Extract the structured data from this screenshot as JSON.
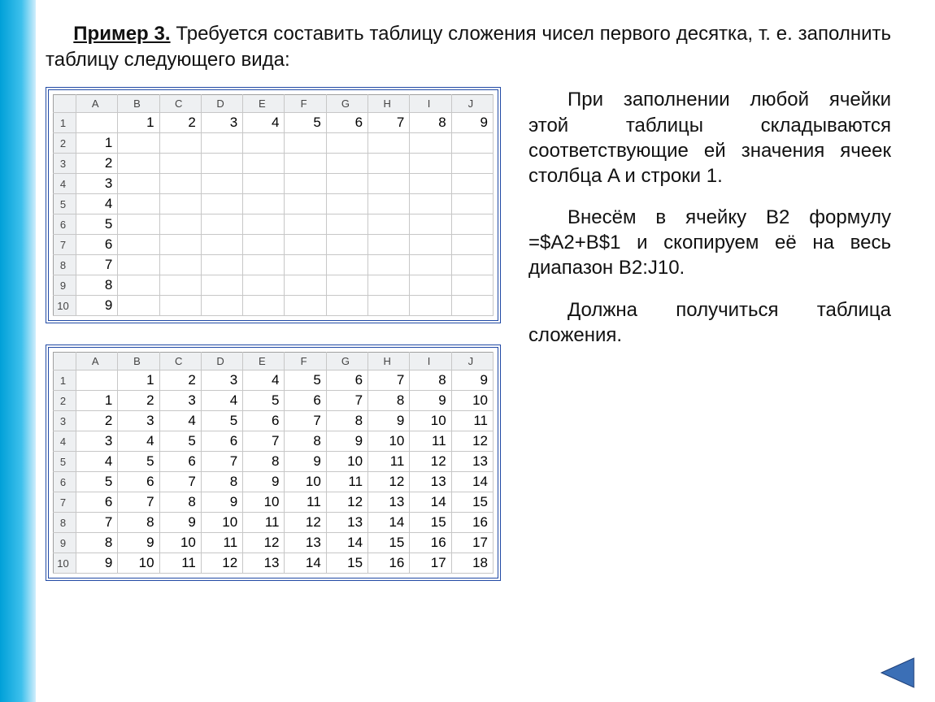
{
  "intro": {
    "example_label": "Пример 3.",
    "text_after": " Требуется составить таблицу сложения чисел первого десятка, т. е. заполнить таблицу следующего вида:"
  },
  "right_text": {
    "p1": "При заполнении любой ячейки этой таблицы складываются соответствующие ей значения ячеек столбца A и строки 1.",
    "p2": "Внесём в ячейку B2 формулу =$A2+B$1 и скопируем её на весь диапазон B2:J10.",
    "p3": "Должна получиться таблица сложения."
  },
  "spreadsheet": {
    "col_labels": [
      "A",
      "B",
      "C",
      "D",
      "E",
      "F",
      "G",
      "H",
      "I",
      "J"
    ],
    "row_labels": [
      "1",
      "2",
      "3",
      "4",
      "5",
      "6",
      "7",
      "8",
      "9",
      "10"
    ]
  },
  "sheet1_data": [
    [
      "",
      "1",
      "2",
      "3",
      "4",
      "5",
      "6",
      "7",
      "8",
      "9"
    ],
    [
      "1",
      "",
      "",
      "",
      "",
      "",
      "",
      "",
      "",
      ""
    ],
    [
      "2",
      "",
      "",
      "",
      "",
      "",
      "",
      "",
      "",
      ""
    ],
    [
      "3",
      "",
      "",
      "",
      "",
      "",
      "",
      "",
      "",
      ""
    ],
    [
      "4",
      "",
      "",
      "",
      "",
      "",
      "",
      "",
      "",
      ""
    ],
    [
      "5",
      "",
      "",
      "",
      "",
      "",
      "",
      "",
      "",
      ""
    ],
    [
      "6",
      "",
      "",
      "",
      "",
      "",
      "",
      "",
      "",
      ""
    ],
    [
      "7",
      "",
      "",
      "",
      "",
      "",
      "",
      "",
      "",
      ""
    ],
    [
      "8",
      "",
      "",
      "",
      "",
      "",
      "",
      "",
      "",
      ""
    ],
    [
      "9",
      "",
      "",
      "",
      "",
      "",
      "",
      "",
      "",
      ""
    ]
  ],
  "sheet2_data": [
    [
      "",
      "1",
      "2",
      "3",
      "4",
      "5",
      "6",
      "7",
      "8",
      "9"
    ],
    [
      "1",
      "2",
      "3",
      "4",
      "5",
      "6",
      "7",
      "8",
      "9",
      "10"
    ],
    [
      "2",
      "3",
      "4",
      "5",
      "6",
      "7",
      "8",
      "9",
      "10",
      "11"
    ],
    [
      "3",
      "4",
      "5",
      "6",
      "7",
      "8",
      "9",
      "10",
      "11",
      "12"
    ],
    [
      "4",
      "5",
      "6",
      "7",
      "8",
      "9",
      "10",
      "11",
      "12",
      "13"
    ],
    [
      "5",
      "6",
      "7",
      "8",
      "9",
      "10",
      "11",
      "12",
      "13",
      "14"
    ],
    [
      "6",
      "7",
      "8",
      "9",
      "10",
      "11",
      "12",
      "13",
      "14",
      "15"
    ],
    [
      "7",
      "8",
      "9",
      "10",
      "11",
      "12",
      "13",
      "14",
      "15",
      "16"
    ],
    [
      "8",
      "9",
      "10",
      "11",
      "12",
      "13",
      "14",
      "15",
      "16",
      "17"
    ],
    [
      "9",
      "10",
      "11",
      "12",
      "13",
      "14",
      "15",
      "16",
      "17",
      "18"
    ]
  ],
  "nav": {
    "prev_label": "previous-slide"
  }
}
